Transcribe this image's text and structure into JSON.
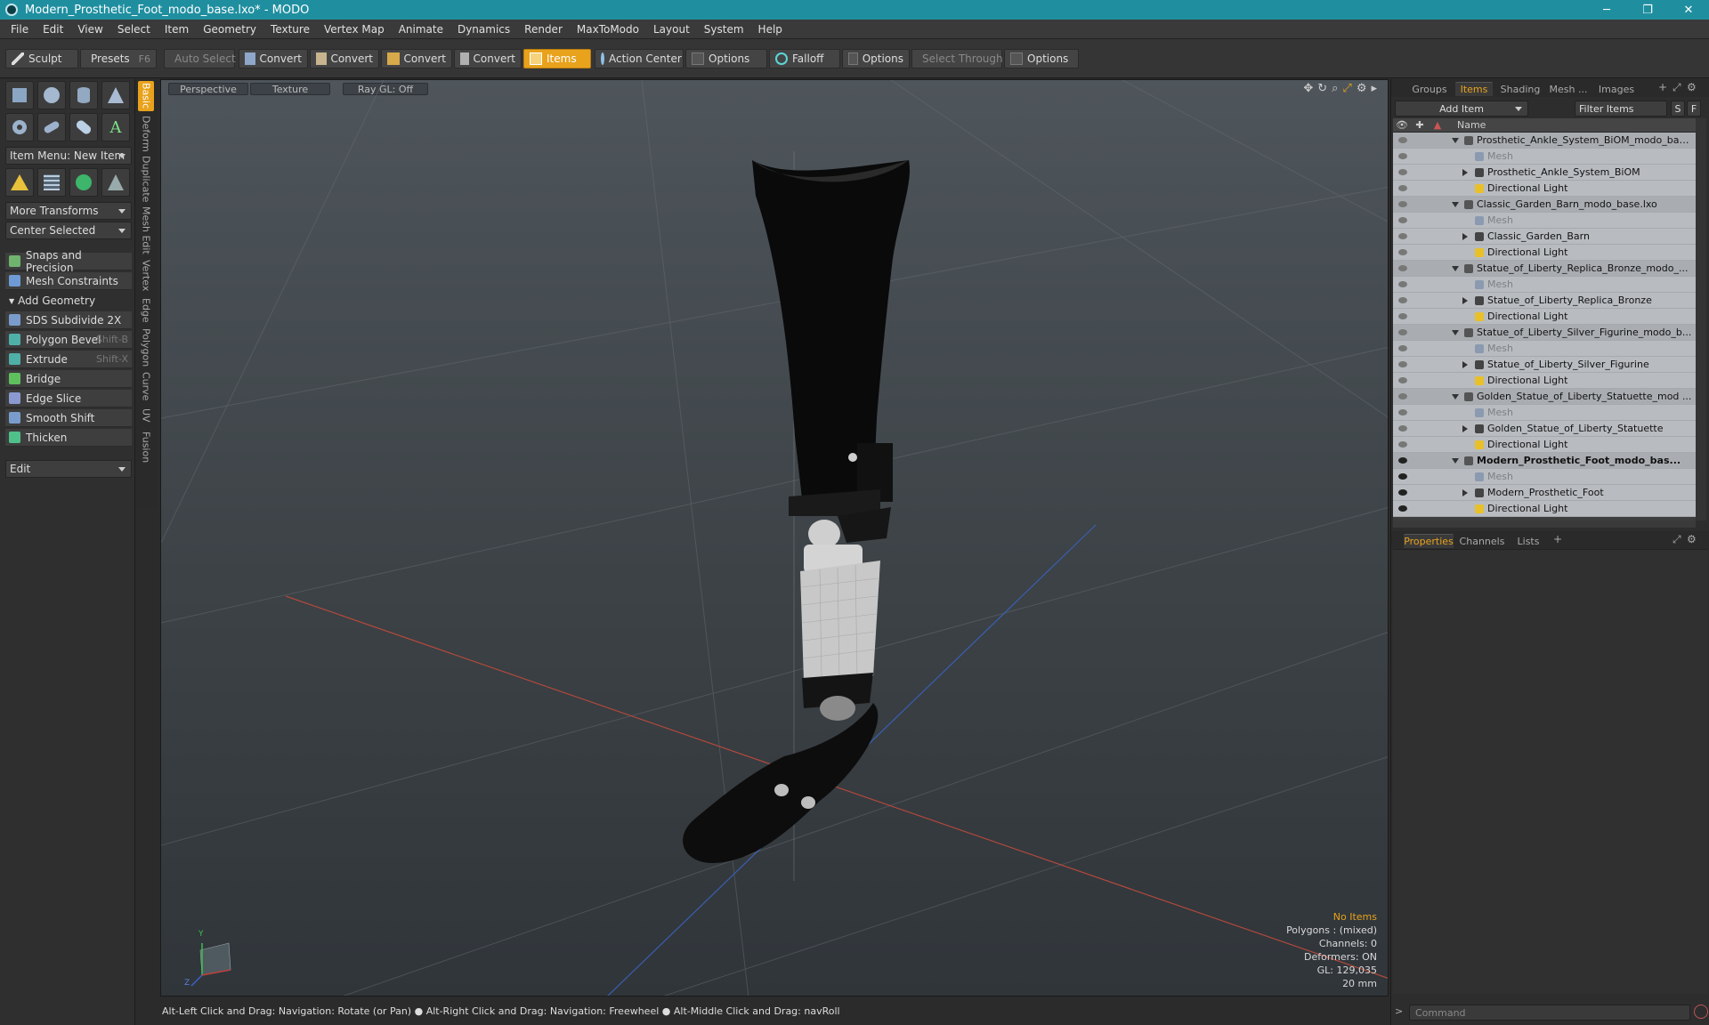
{
  "window": {
    "title": "Modern_Prosthetic_Foot_modo_base.lxo* - MODO",
    "minimize": "─",
    "maximize": "❐",
    "close": "✕"
  },
  "menu": [
    "File",
    "Edit",
    "View",
    "Select",
    "Item",
    "Geometry",
    "Texture",
    "Vertex Map",
    "Animate",
    "Dynamics",
    "Render",
    "MaxToModo",
    "Layout",
    "System",
    "Help"
  ],
  "toolbar": {
    "sculpt": "Sculpt",
    "presets": "Presets",
    "presets_hotkey": "F6",
    "auto_select": "Auto Select",
    "convert1": "Convert",
    "convert2": "Convert",
    "convert3": "Convert",
    "convert4": "Convert",
    "items": "Items",
    "action_center": "Action Center",
    "options1": "Options",
    "falloff": "Falloff",
    "options2": "Options",
    "select_through": "Select Through",
    "options3": "Options"
  },
  "left": {
    "item_menu": "Item Menu: New Item",
    "more_transforms": "More Transforms",
    "center_selected": "Center Selected",
    "snaps": "Snaps and Precision",
    "mesh_constraints": "Mesh Constraints",
    "add_geometry": "Add Geometry",
    "tools": [
      {
        "label": "SDS Subdivide 2X",
        "hotkey": ""
      },
      {
        "label": "Polygon Bevel",
        "hotkey": "Shift-B"
      },
      {
        "label": "Extrude",
        "hotkey": "Shift-X"
      },
      {
        "label": "Bridge",
        "hotkey": ""
      },
      {
        "label": "Edge Slice",
        "hotkey": ""
      },
      {
        "label": "Smooth Shift",
        "hotkey": ""
      },
      {
        "label": "Thicken",
        "hotkey": ""
      }
    ],
    "edit": "Edit",
    "vtabs": [
      "Basic",
      "Deform",
      "Duplicate",
      "Mesh Edit",
      "Vertex",
      "Edge",
      "Polygon",
      "Curve",
      "UV",
      "Fusion"
    ]
  },
  "viewport": {
    "tab_perspective": "Perspective",
    "tab_texture": "Texture",
    "tab_raygl": "Ray GL: Off",
    "info": {
      "no_items": "No Items",
      "polygons": "Polygons : (mixed)",
      "channels": "Channels: 0",
      "deformers": "Deformers: ON",
      "gl": "GL: 129,035",
      "scale": "20 mm"
    },
    "axis_y": "Y",
    "axis_z": "Z"
  },
  "status": "Alt-Left Click and Drag: Navigation: Rotate (or Pan) ● Alt-Right Click and Drag: Navigation: Freewheel ● Alt-Middle Click and Drag: navRoll",
  "right": {
    "tabs": [
      "Groups",
      "Items",
      "Shading",
      "Mesh ...",
      "Images"
    ],
    "add_item": "Add Item",
    "filter_items": "Filter Items",
    "btn_s": "S",
    "btn_f": "F",
    "col_name": "Name",
    "rows": [
      {
        "label": "Prosthetic_Ankle_System_BiOM_modo_bas...",
        "kind": "scene"
      },
      {
        "label": "Mesh",
        "kind": "mesh"
      },
      {
        "label": "Prosthetic_Ankle_System_BiOM",
        "kind": "group"
      },
      {
        "label": "Directional Light",
        "kind": "light"
      },
      {
        "label": "Classic_Garden_Barn_modo_base.lxo",
        "kind": "scene"
      },
      {
        "label": "Mesh",
        "kind": "mesh"
      },
      {
        "label": "Classic_Garden_Barn",
        "kind": "group"
      },
      {
        "label": "Directional Light",
        "kind": "light"
      },
      {
        "label": "Statue_of_Liberty_Replica_Bronze_modo_...",
        "kind": "scene"
      },
      {
        "label": "Mesh",
        "kind": "mesh"
      },
      {
        "label": "Statue_of_Liberty_Replica_Bronze",
        "kind": "group"
      },
      {
        "label": "Directional Light",
        "kind": "light"
      },
      {
        "label": "Statue_of_Liberty_Silver_Figurine_modo_b...",
        "kind": "scene"
      },
      {
        "label": "Mesh",
        "kind": "mesh"
      },
      {
        "label": "Statue_of_Liberty_Silver_Figurine",
        "kind": "group"
      },
      {
        "label": "Directional Light",
        "kind": "light"
      },
      {
        "label": "Golden_Statue_of_Liberty_Statuette_mod ...",
        "kind": "scene"
      },
      {
        "label": "Mesh",
        "kind": "mesh"
      },
      {
        "label": "Golden_Statue_of_Liberty_Statuette",
        "kind": "group"
      },
      {
        "label": "Directional Light",
        "kind": "light"
      },
      {
        "label": "Modern_Prosthetic_Foot_modo_bas...",
        "kind": "scene-bold"
      },
      {
        "label": "Mesh",
        "kind": "mesh"
      },
      {
        "label": "Modern_Prosthetic_Foot",
        "kind": "group"
      },
      {
        "label": "Directional Light",
        "kind": "light"
      }
    ],
    "props_tabs": [
      "Properties",
      "Channels",
      "Lists"
    ],
    "command_placeholder": "Command"
  }
}
